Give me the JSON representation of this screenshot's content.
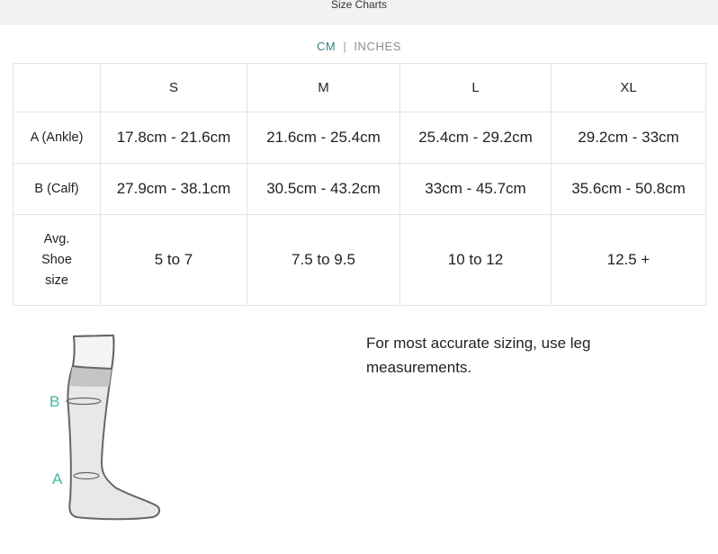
{
  "header": {
    "title": "Size Charts"
  },
  "unit_toggle": {
    "options": [
      "CM",
      "INCHES"
    ],
    "selected": "CM",
    "separator": "|"
  },
  "size_table": {
    "columns": [
      "",
      "S",
      "M",
      "L",
      "XL"
    ],
    "rows": [
      {
        "label": "A (Ankle)",
        "values": [
          "17.8cm - 21.6cm",
          "21.6cm - 25.4cm",
          "25.4cm - 29.2cm",
          "29.2cm - 33cm"
        ]
      },
      {
        "label": "B (Calf)",
        "values": [
          "27.9cm - 38.1cm",
          "30.5cm - 43.2cm",
          "33cm - 45.7cm",
          "35.6cm - 50.8cm"
        ]
      },
      {
        "label_lines": [
          "Avg.",
          "Shoe",
          "size"
        ],
        "values": [
          "5 to 7",
          "7.5 to 9.5",
          "10 to 12",
          "12.5 +"
        ]
      }
    ]
  },
  "diagram": {
    "labels": {
      "calf": "B",
      "ankle": "A"
    },
    "label_color": "#3fb8a4"
  },
  "note": {
    "text": "For most accurate sizing, use leg measurements."
  },
  "colors": {
    "accent": "#3a7f80",
    "inactive": "#8d8d8d",
    "border": "#e3e3e3",
    "header_bg": "#f2f2f2"
  }
}
